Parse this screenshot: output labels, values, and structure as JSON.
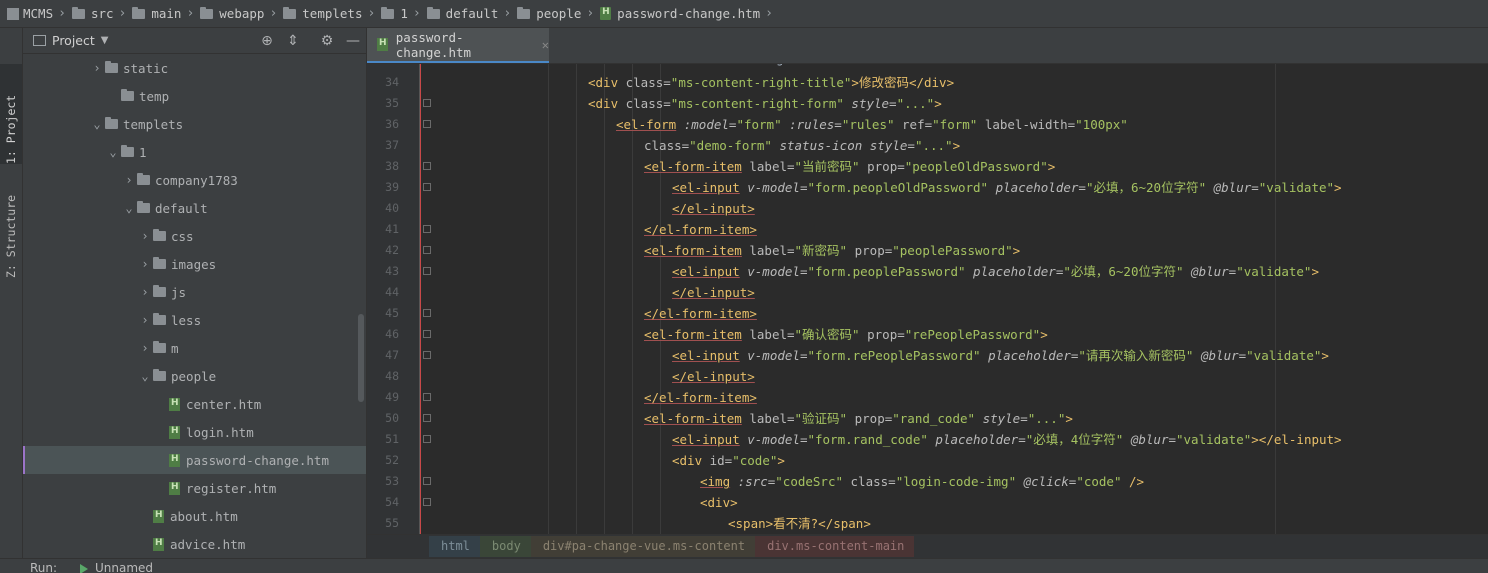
{
  "breadcrumb": [
    {
      "label": "MCMS",
      "icon": "app-icon"
    },
    {
      "label": "src",
      "icon": "folder-icon"
    },
    {
      "label": "main",
      "icon": "folder-icon"
    },
    {
      "label": "webapp",
      "icon": "folder-icon"
    },
    {
      "label": "templets",
      "icon": "folder-icon"
    },
    {
      "label": "1",
      "icon": "folder-icon"
    },
    {
      "label": "default",
      "icon": "folder-icon"
    },
    {
      "label": "people",
      "icon": "folder-icon"
    },
    {
      "label": "password-change.htm",
      "icon": "html-file-icon"
    }
  ],
  "side_stripe": {
    "project": "1: Project",
    "structure": "Z: Structure"
  },
  "project_panel": {
    "title": "Project",
    "tree": [
      {
        "label": "static",
        "type": "folder",
        "arrow": "right"
      },
      {
        "label": "temp",
        "type": "folder",
        "arrow": "none"
      },
      {
        "label": "templets",
        "type": "folder",
        "arrow": "down"
      },
      {
        "label": "1",
        "type": "folder",
        "arrow": "down"
      },
      {
        "label": "company1783",
        "type": "folder",
        "arrow": "right"
      },
      {
        "label": "default",
        "type": "folder",
        "arrow": "down"
      },
      {
        "label": "css",
        "type": "folder",
        "arrow": "right"
      },
      {
        "label": "images",
        "type": "folder",
        "arrow": "right"
      },
      {
        "label": "js",
        "type": "folder",
        "arrow": "right"
      },
      {
        "label": "less",
        "type": "folder",
        "arrow": "right"
      },
      {
        "label": "m",
        "type": "folder",
        "arrow": "right"
      },
      {
        "label": "people",
        "type": "folder",
        "arrow": "down"
      },
      {
        "label": "center.htm",
        "type": "file"
      },
      {
        "label": "login.htm",
        "type": "file"
      },
      {
        "label": "password-change.htm",
        "type": "file",
        "selected": true
      },
      {
        "label": "register.htm",
        "type": "file"
      },
      {
        "label": "about.htm",
        "type": "file"
      },
      {
        "label": "advice.htm",
        "type": "file"
      }
    ]
  },
  "editor": {
    "tab_label": "password-change.htm",
    "partial_line": "<div class=\"ms-content-right\">",
    "line_numbers": [
      "34",
      "35",
      "36",
      "37",
      "38",
      "39",
      "40",
      "41",
      "42",
      "43",
      "44",
      "45",
      "46",
      "47",
      "48",
      "49",
      "50",
      "51",
      "52",
      "53",
      "54",
      "55"
    ],
    "tokens": [
      [
        "<div",
        " class=",
        "\"ms-content-right-title\"",
        ">修改密码</div>"
      ],
      [
        "<div",
        " class=",
        "\"ms-content-right-form\"",
        " style=",
        "\"...\"",
        ">"
      ],
      [
        "<el-form",
        " :model=",
        "\"form\"",
        " :rules=",
        "\"rules\"",
        " ref=",
        "\"form\"",
        " label-width=",
        "\"100px\""
      ],
      [
        "class=",
        "\"demo-form\"",
        " status-icon",
        " style=",
        "\"...\"",
        ">"
      ],
      [
        "<el-form-item",
        " label=",
        "\"当前密码\"",
        " prop=",
        "\"peopleOldPassword\"",
        ">"
      ],
      [
        "<el-input",
        " v-model=",
        "\"form.peopleOldPassword\"",
        " placeholder=",
        "\"必填，6~20位字符\"",
        " @blur=",
        "\"validate\"",
        ">"
      ],
      [
        "</el-input>"
      ],
      [
        "</el-form-item>"
      ],
      [
        "<el-form-item",
        " label=",
        "\"新密码\"",
        " prop=",
        "\"peoplePassword\"",
        ">"
      ],
      [
        "<el-input",
        " v-model=",
        "\"form.peoplePassword\"",
        " placeholder=",
        "\"必填，6~20位字符\"",
        " @blur=",
        "\"validate\"",
        ">"
      ],
      [
        "</el-input>"
      ],
      [
        "</el-form-item>"
      ],
      [
        "<el-form-item",
        " label=",
        "\"确认密码\"",
        " prop=",
        "\"rePeoplePassword\"",
        ">"
      ],
      [
        "<el-input",
        " v-model=",
        "\"form.rePeoplePassword\"",
        " placeholder=",
        "\"请再次输入新密码\"",
        " @blur=",
        "\"validate\"",
        ">"
      ],
      [
        "</el-input>"
      ],
      [
        "</el-form-item>"
      ],
      [
        "<el-form-item",
        " label=",
        "\"验证码\"",
        " prop=",
        "\"rand_code\"",
        " style=",
        "\"...\"",
        ">"
      ],
      [
        "<el-input",
        " v-model=",
        "\"form.rand_code\"",
        " placeholder=",
        "\"必填，4位字符\"",
        " @blur=",
        "\"validate\"",
        "></el-input>"
      ],
      [
        "<div",
        " id=",
        "\"code\"",
        ">"
      ],
      [
        "<img",
        " :src=",
        "\"codeSrc\"",
        " class=",
        "\"login-code-img\"",
        " @click=",
        "\"code\"",
        " />"
      ],
      [
        "<div>"
      ],
      [
        "<span>看不清?</span>"
      ]
    ]
  },
  "editor_breadcrumb": [
    "html",
    "body",
    "div#pa-change-vue.ms-content",
    "div.ms-content-main"
  ],
  "run_bar": {
    "label": "Run:",
    "config": "Unnamed"
  }
}
